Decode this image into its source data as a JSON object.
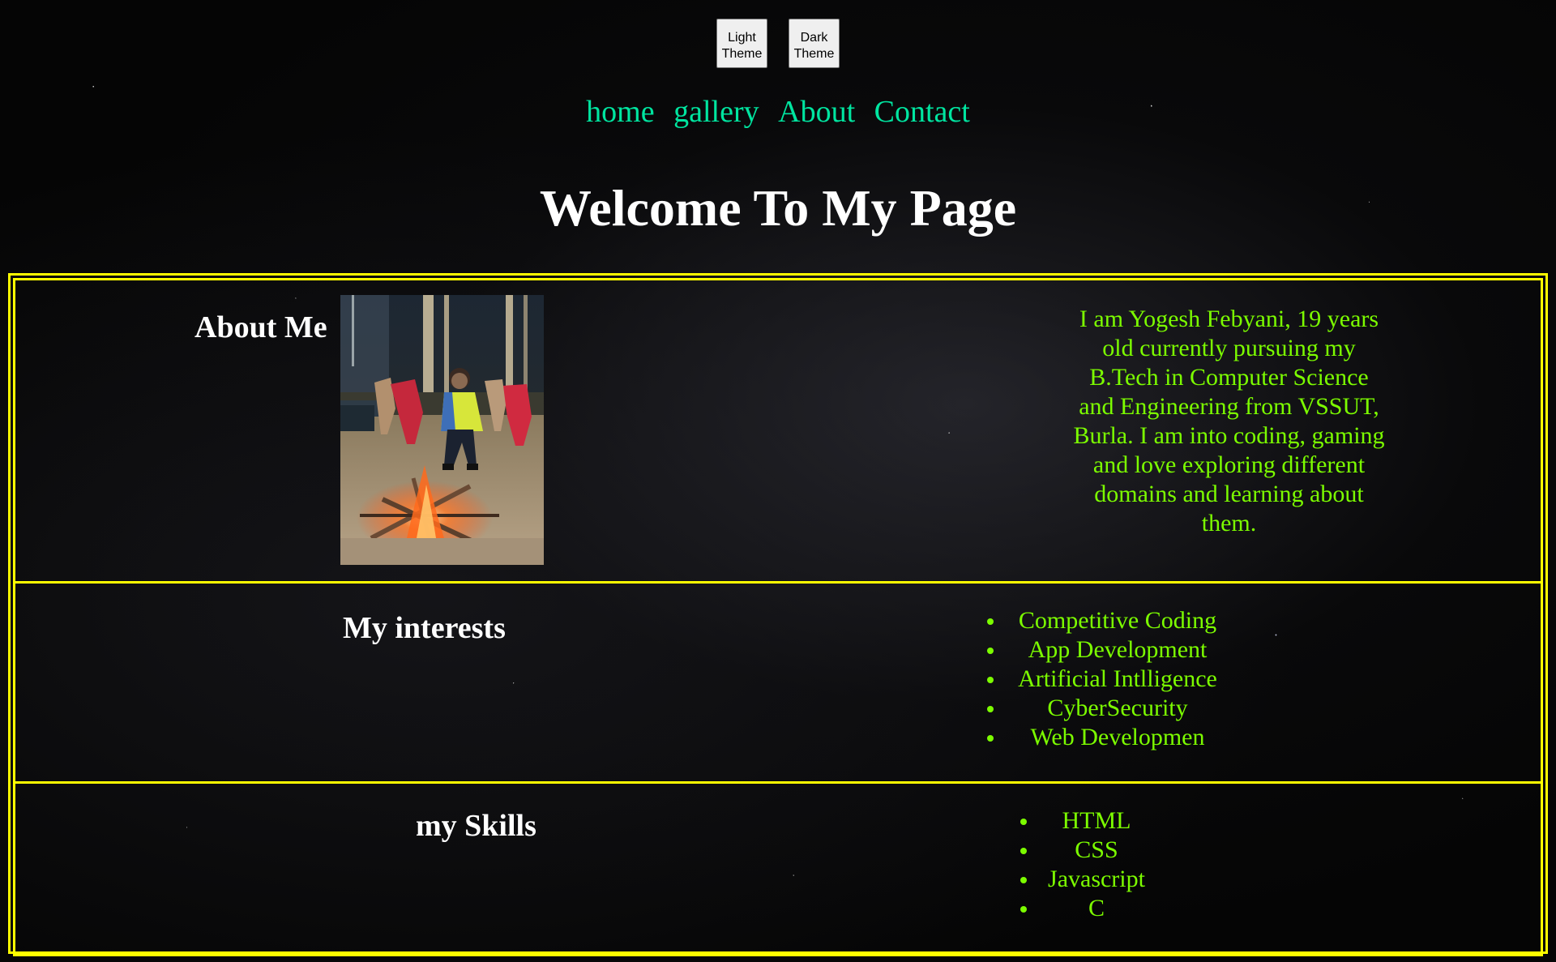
{
  "theme_buttons": {
    "light_label": "Light Theme",
    "dark_label": "Dark Theme"
  },
  "nav": {
    "items": [
      {
        "label": "home"
      },
      {
        "label": "gallery"
      },
      {
        "label": "About"
      },
      {
        "label": "Contact"
      }
    ]
  },
  "page": {
    "title": "Welcome To My Page"
  },
  "about": {
    "heading": "About Me",
    "description": "I am Yogesh Febyani, 19 years old currently pursuing my B.Tech in Computer Science and Engineering from VSSUT, Burla. I am into coding, gaming and love exploring different domains and learning about them."
  },
  "interests": {
    "heading": "My interests",
    "items": [
      "Competitive Coding",
      "App Development",
      "Artificial Intlligence",
      "CyberSecurity",
      "Web Developmen"
    ]
  },
  "skills": {
    "heading": "my Skills",
    "items": [
      "HTML",
      "CSS",
      "Javascript",
      "C"
    ]
  },
  "colors": {
    "nav_link": "#00e5a0",
    "body_text": "#7cfc00",
    "border": "#ffff00",
    "heading": "#ffffff",
    "background": "#050505"
  }
}
